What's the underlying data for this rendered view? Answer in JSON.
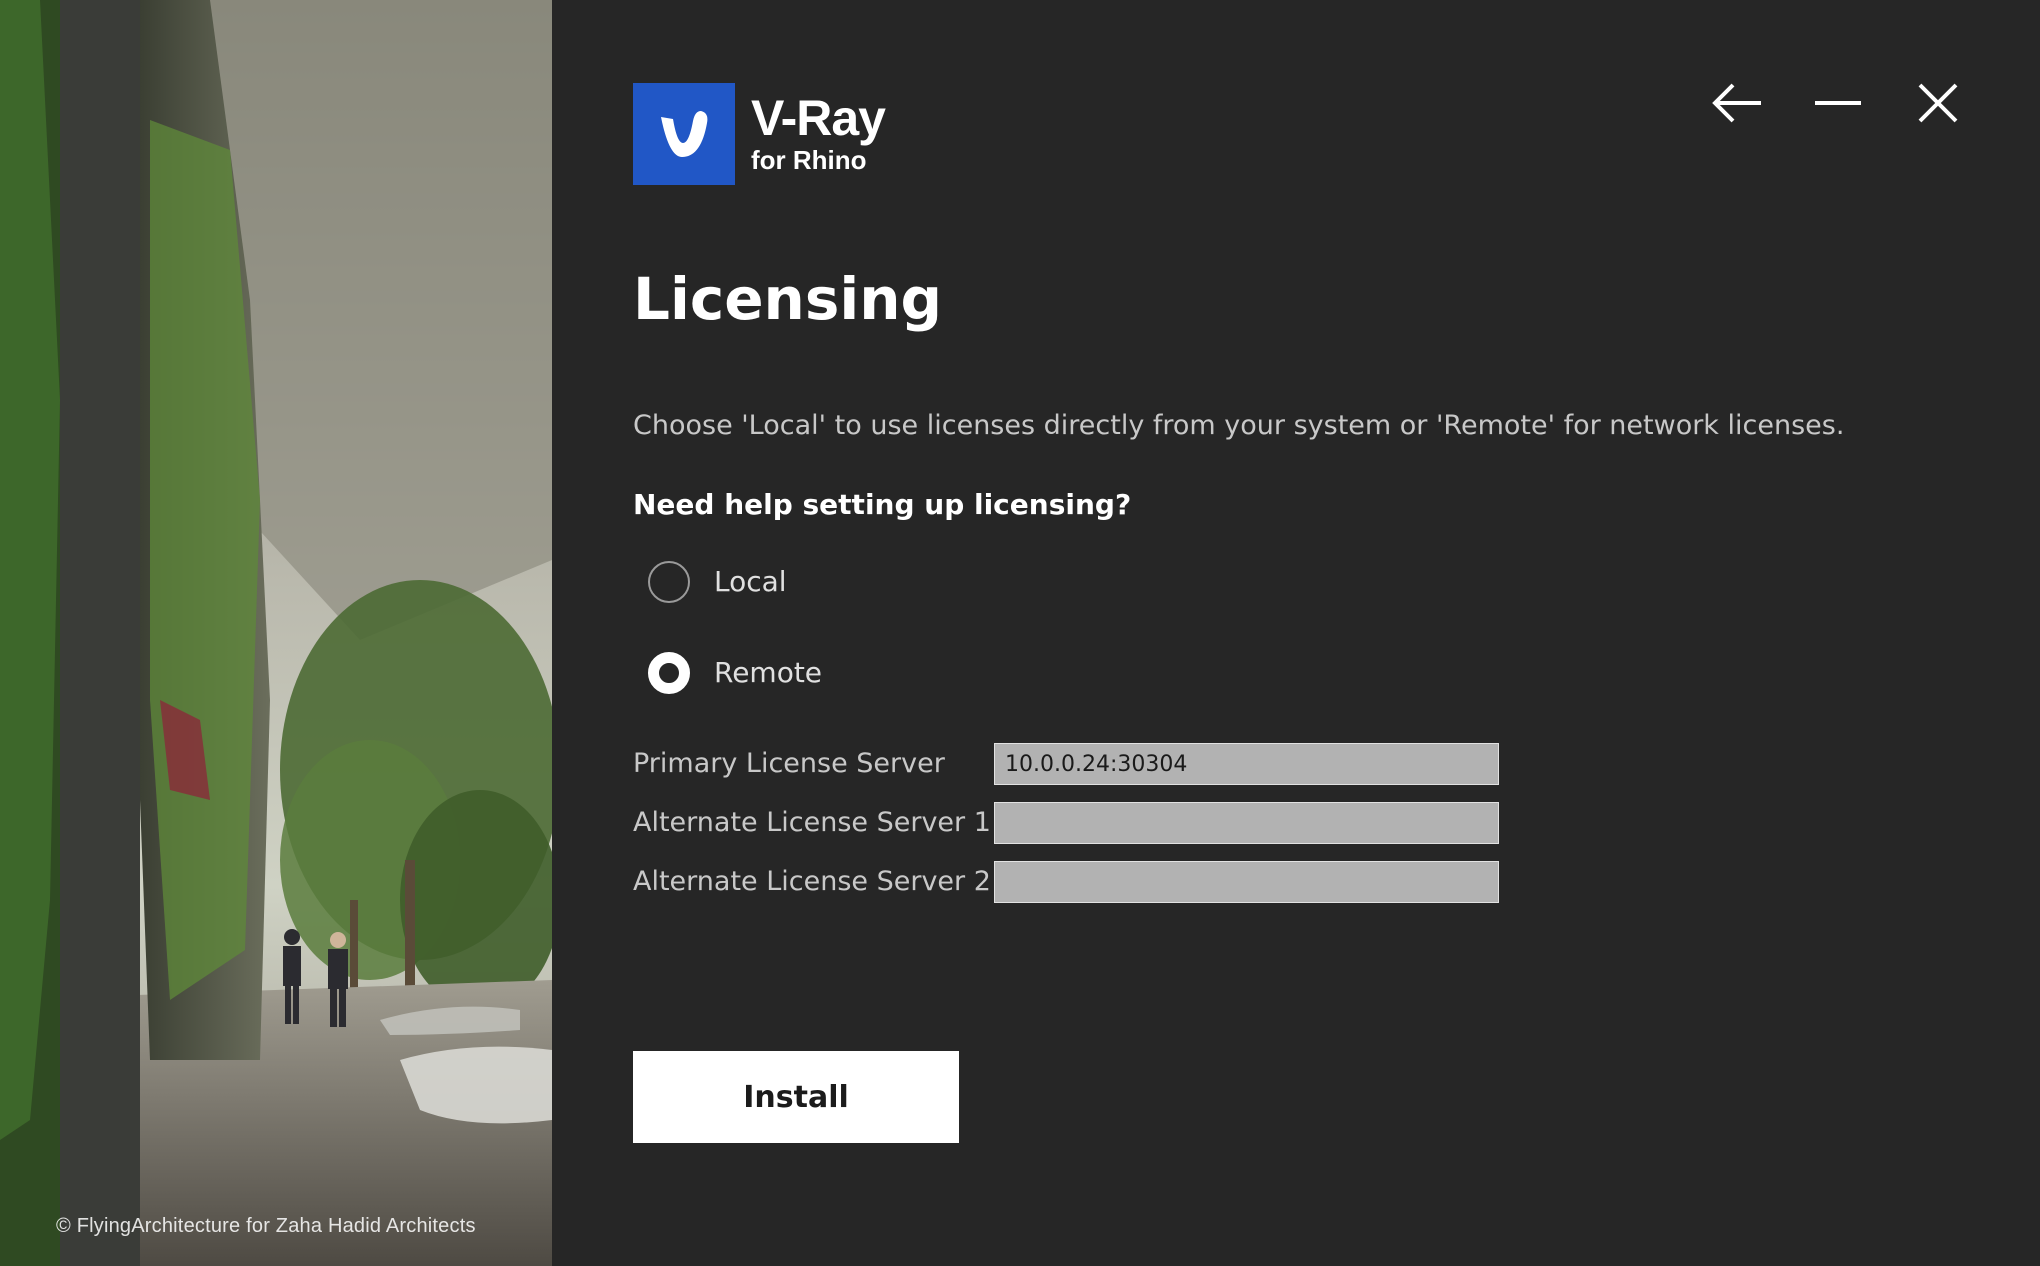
{
  "hero": {
    "credit": "© FlyingArchitecture for Zaha Hadid Architects"
  },
  "brand": {
    "title": "V-Ray",
    "subtitle": "for Rhino",
    "mark_color": "#2157c6"
  },
  "window_controls": {
    "back_icon": "arrow-left-icon",
    "minimize_icon": "minimize-icon",
    "close_icon": "close-icon"
  },
  "page": {
    "title": "Licensing",
    "description": "Choose 'Local' to use licenses directly from your system or 'Remote' for network licenses.",
    "help_link": "Need help setting up licensing?"
  },
  "license_mode": {
    "options": [
      {
        "label": "Local",
        "selected": false
      },
      {
        "label": "Remote",
        "selected": true
      }
    ]
  },
  "servers": [
    {
      "label": "Primary License Server",
      "value": "10.0.0.24:30304",
      "placeholder": ""
    },
    {
      "label": "Alternate License Server 1",
      "value": "",
      "placeholder": ""
    },
    {
      "label": "Alternate License Server 2",
      "value": "",
      "placeholder": ""
    }
  ],
  "actions": {
    "install_label": "Install"
  },
  "colors": {
    "background": "#262626",
    "text_primary": "#ffffff",
    "text_secondary": "#c8c8c8",
    "input_background": "#b2b2b2",
    "button_background": "#ffffff"
  }
}
